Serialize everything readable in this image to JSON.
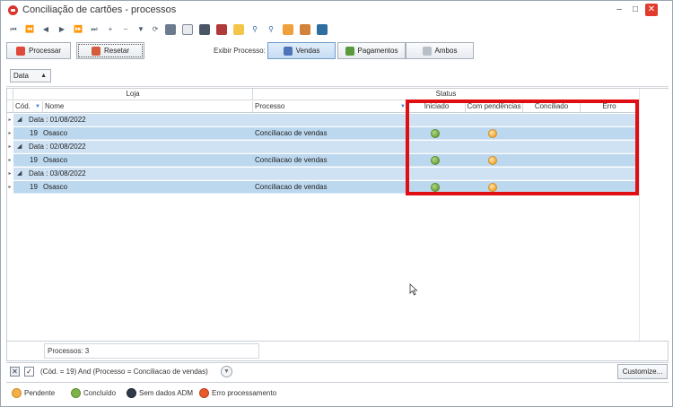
{
  "window": {
    "title": "Conciliação de cartões - processos"
  },
  "actions": {
    "processar": "Processar",
    "resetar": "Resetar",
    "exibir_label": "Exibir Processo:",
    "vendas": "Vendas",
    "pagamentos": "Pagamentos",
    "ambos": "Ambos"
  },
  "groupby": {
    "field": "Data"
  },
  "grid": {
    "band_loja": "Loja",
    "band_status": "Status",
    "col_cod": "Cód.",
    "col_nome": "Nome",
    "col_processo": "Processo",
    "col_iniciado": "Iniciado",
    "col_pendencias": "Com pendências",
    "col_conciliado": "Conciliado",
    "col_erro": "Erro",
    "groups": [
      {
        "label": "Data : 01/08/2022",
        "cod": "19",
        "nome": "Osasco",
        "processo": "Conciliacao de vendas"
      },
      {
        "label": "Data : 02/08/2022",
        "cod": "19",
        "nome": "Osasco",
        "processo": "Conciliacao de vendas"
      },
      {
        "label": "Data : 03/08/2022",
        "cod": "19",
        "nome": "Osasco",
        "processo": "Conciliacao de vendas"
      }
    ]
  },
  "summary": {
    "text": "Processos: 3"
  },
  "filter": {
    "text": "(Cód. = 19) And (Processo = Conciliacao de vendas)",
    "customize": "Customize..."
  },
  "legend": {
    "pendente": "Pendente",
    "concluido": "Concluído",
    "sem_dados": "Sem dados ADM",
    "erro": "Erro processamento"
  },
  "colors": {
    "highlight": "#e00d12",
    "row_bg": "#bcd8ef",
    "green": "#7db34a",
    "orange": "#f2b04a",
    "dark": "#2f3a4a",
    "red": "#e65a2c"
  }
}
